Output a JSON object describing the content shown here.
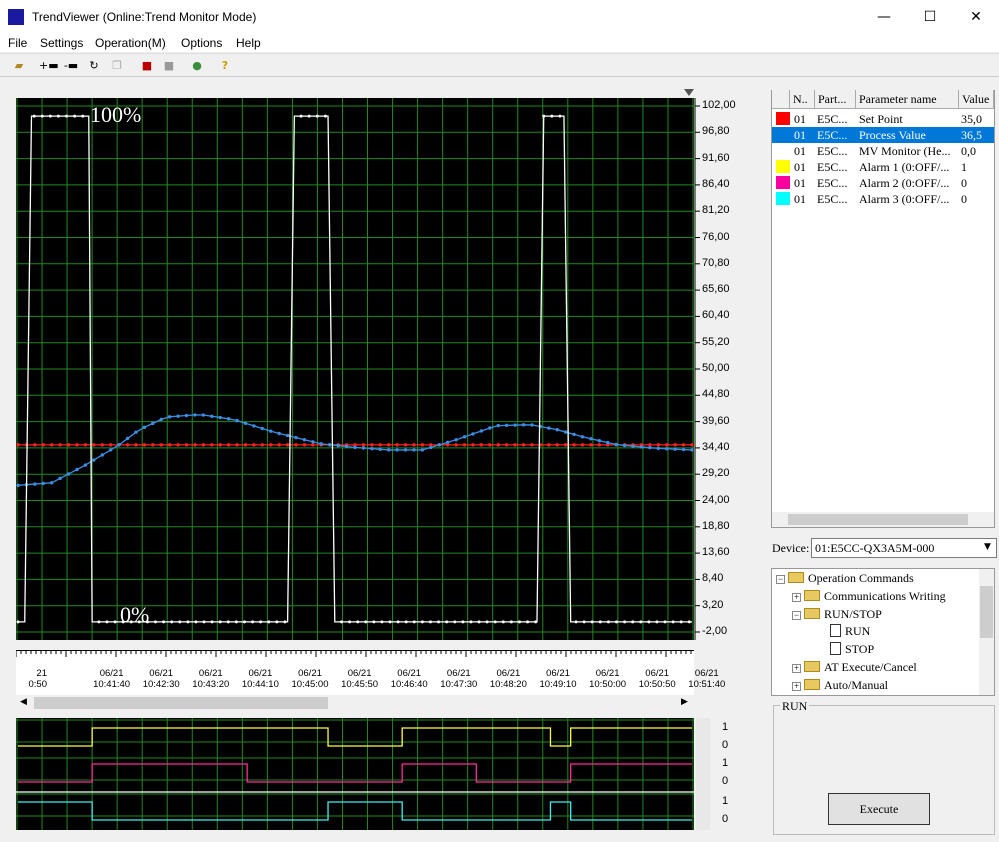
{
  "window": {
    "title": "TrendViewer (Online:Trend Monitor Mode)",
    "minimize": "—",
    "maximize": "☐",
    "close": "✕"
  },
  "menu": [
    "File",
    "Settings",
    "Operation(M)",
    "Options",
    "Help"
  ],
  "toolbar": [
    "open-folder-icon",
    "add-item-icon",
    "remove-item-icon",
    "refresh-icon",
    "copy-icon",
    "add-device-icon",
    "remove-device-icon",
    "color-wheel-icon",
    "help-icon"
  ],
  "chart": {
    "labels": {
      "high": "100%",
      "low": "0%"
    },
    "y_ticks": [
      "102,00",
      "96,80",
      "91,60",
      "86,40",
      "81,20",
      "76,00",
      "70,80",
      "65,60",
      "60,40",
      "55,20",
      "50,00",
      "44,80",
      "39,60",
      "34,40",
      "29,20",
      "24,00",
      "18,80",
      "13,60",
      "8,40",
      "3,20",
      "-2,00"
    ],
    "x_dates": [
      "21",
      "06/21",
      "06/21",
      "06/21",
      "06/21",
      "06/21",
      "06/21",
      "06/21",
      "06/21",
      "06/21",
      "06/21",
      "06/21",
      "06/21",
      "06/21"
    ],
    "x_times": [
      "0:50",
      "10:41:40",
      "10:42:30",
      "10:43:20",
      "10:44:10",
      "10:45:00",
      "10:45:50",
      "10:46:40",
      "10:47:30",
      "10:48:20",
      "10:49:10",
      "10:50:00",
      "10:50:50",
      "10:51:40"
    ],
    "colors": {
      "set_point": "#ff2020",
      "process_value": "#3a8ee8",
      "mv": "#ffffff",
      "alarm1": "#ffff40",
      "alarm2": "#ff2a9a",
      "alarm3": "#40f0f0",
      "grid": "#1f8a1f"
    }
  },
  "chart_data": {
    "type": "line",
    "ylim": [
      -2.0,
      102.0
    ],
    "series": [
      {
        "name": "Set Point",
        "values_constant": 35.0
      },
      {
        "name": "Process Value",
        "x": [
          0,
          5,
          10,
          15,
          18,
          22,
          27,
          32,
          38,
          45,
          50,
          55,
          60,
          65,
          71,
          76,
          80,
          84,
          89,
          95,
          100
        ],
        "values": [
          27,
          27.5,
          31,
          35,
          38,
          40.5,
          41,
          40,
          37.5,
          35.2,
          34.5,
          34,
          34,
          36,
          38.8,
          39,
          38,
          36.5,
          35,
          34.3,
          34
        ]
      },
      {
        "name": "MV Monitor (Heating)",
        "x": [
          0,
          1,
          2,
          10.5,
          11,
          12,
          40,
          41,
          42,
          46,
          47,
          48,
          77,
          78,
          79,
          81,
          82,
          83,
          100
        ],
        "values": [
          0,
          0,
          100,
          100,
          0,
          0,
          0,
          100,
          100,
          100,
          0,
          0,
          0,
          100,
          100,
          100,
          0,
          0,
          0
        ]
      }
    ],
    "alarms": {
      "alarm1": [
        0,
        1,
        1,
        0,
        1,
        1,
        0,
        1,
        1
      ],
      "alarm2": [
        0,
        1,
        0,
        0,
        1,
        0,
        0,
        1,
        0
      ],
      "alarm3": [
        1,
        0,
        0,
        1,
        0,
        0,
        1,
        0,
        0
      ]
    },
    "sub_ticks": {
      "top": "1",
      "bottom": "0"
    }
  },
  "list": {
    "headers": [
      "N..",
      "Part...",
      "Parameter name",
      "Value"
    ],
    "rows": [
      {
        "n": "01",
        "part": "E5C...",
        "name": "Set Point",
        "value": "35,0",
        "color": "#ff0000",
        "selected": false
      },
      {
        "n": "01",
        "part": "E5C...",
        "name": "Process Value",
        "value": "36,5",
        "color": "#0078d7",
        "selected": true
      },
      {
        "n": "01",
        "part": "E5C...",
        "name": "MV Monitor (He...",
        "value": "0,0",
        "color": "#ffffff",
        "selected": false
      },
      {
        "n": "01",
        "part": "E5C...",
        "name": "Alarm 1 (0:OFF/...",
        "value": "1",
        "color": "#ffff00",
        "selected": false
      },
      {
        "n": "01",
        "part": "E5C...",
        "name": "Alarm 2 (0:OFF/...",
        "value": "0",
        "color": "#ff00a0",
        "selected": false
      },
      {
        "n": "01",
        "part": "E5C...",
        "name": "Alarm 3 (0:OFF/...",
        "value": "0",
        "color": "#00ffff",
        "selected": false
      }
    ]
  },
  "device": {
    "label": "Device:",
    "value": "01:E5CC-QX3A5M-000"
  },
  "tree": {
    "root": "Operation Commands",
    "comm": "Communications Writing",
    "runstop": "RUN/STOP",
    "run": "RUN",
    "stop": "STOP",
    "at": "AT Execute/Cancel",
    "auto": "Auto/Manual"
  },
  "command": {
    "group": "RUN",
    "execute": "Execute"
  }
}
